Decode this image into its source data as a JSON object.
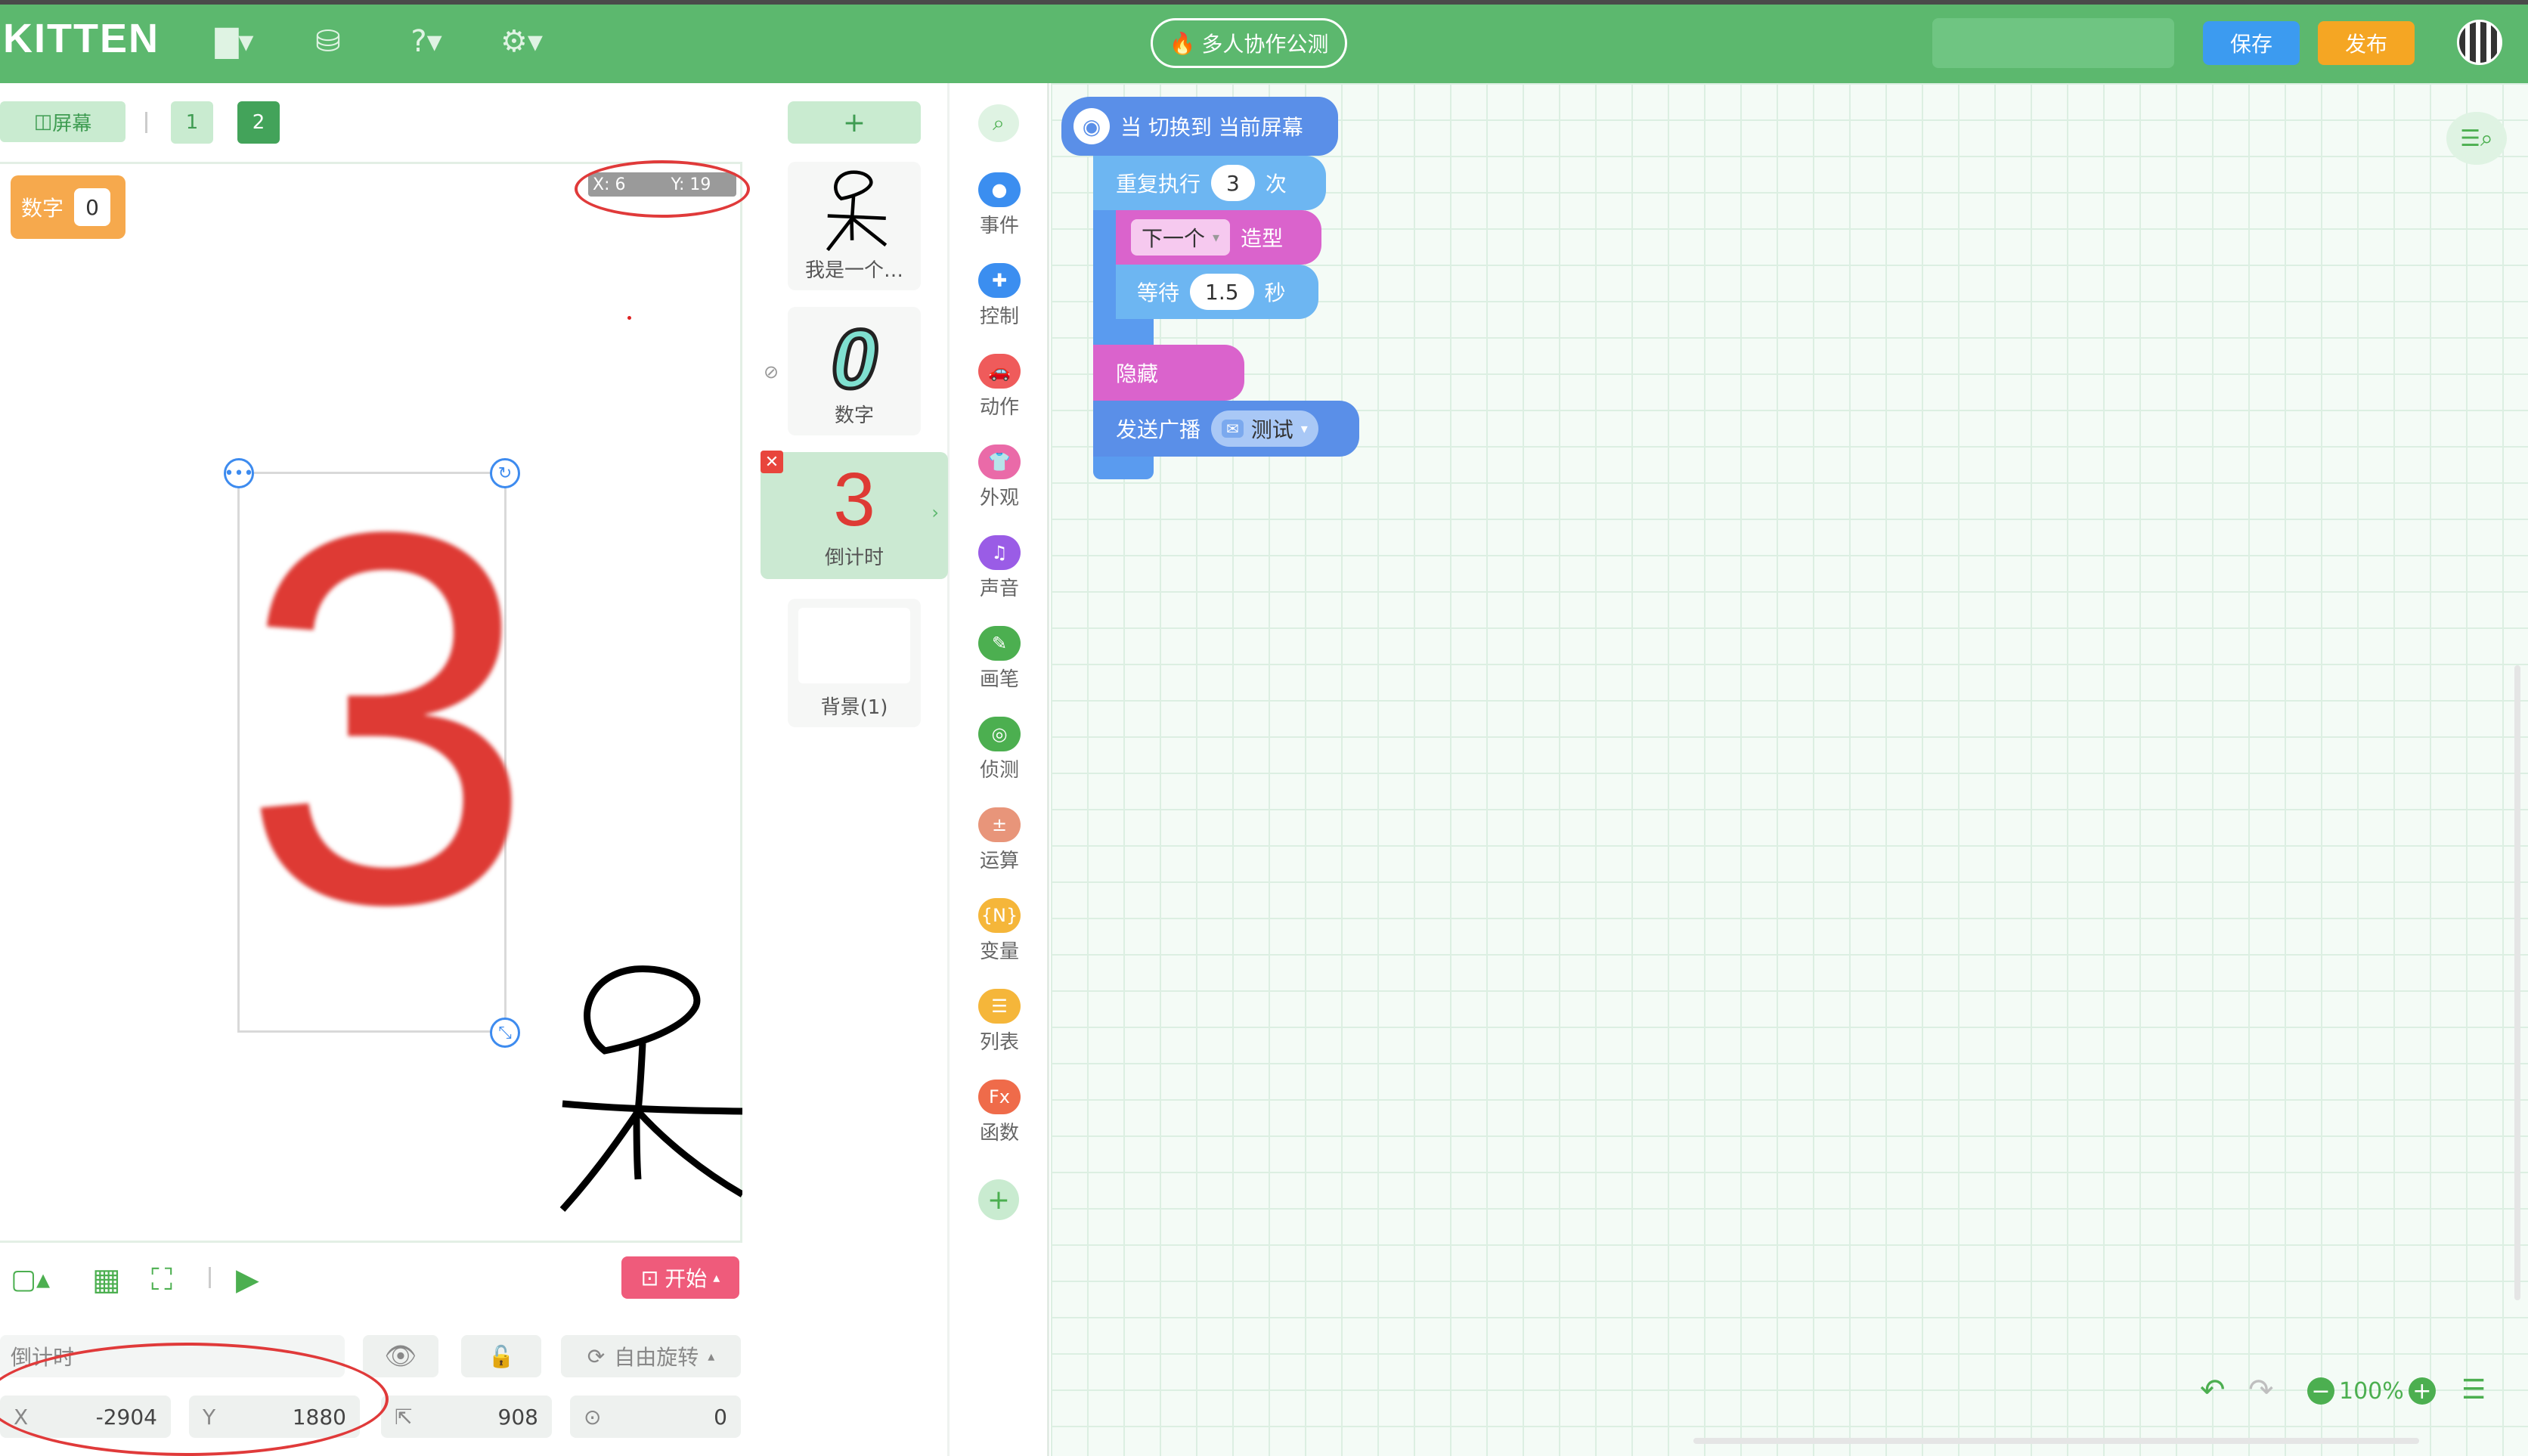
{
  "header": {
    "logo": "KITTEN",
    "collab_label": "多人协作公测",
    "save_label": "保存",
    "publish_label": "发布",
    "icons": [
      "folder-icon",
      "backpack-icon",
      "help-icon",
      "settings-icon"
    ]
  },
  "stage_toolbar": {
    "screen_label": "屏幕",
    "pages": [
      "1",
      "2"
    ],
    "active_page": "2"
  },
  "stage": {
    "variable_monitor": {
      "label": "数字",
      "value": "0"
    },
    "coords_tip": {
      "x": "X: 6",
      "y": "Y: 19"
    },
    "big_number": "3"
  },
  "stage_bottom": {
    "start_label": "开始"
  },
  "properties": {
    "sprite_name_placeholder": "倒计时",
    "rotation_mode": "自由旋转",
    "x_label": "X",
    "x_value": "-2904",
    "y_label": "Y",
    "y_value": "1880",
    "size_value": "908",
    "direction_value": "0"
  },
  "sprites": {
    "add_label": "+",
    "items": [
      {
        "name": "我是一个…"
      },
      {
        "name": "数字",
        "glyph": "0"
      },
      {
        "name": "倒计时",
        "glyph": "3"
      },
      {
        "name": "背景(1)"
      }
    ]
  },
  "categories": [
    {
      "label": "事件",
      "color": "#3b8ef0",
      "icon": "event-icon"
    },
    {
      "label": "控制",
      "color": "#3b8ef0",
      "icon": "control-icon"
    },
    {
      "label": "动作",
      "color": "#ef5b5b",
      "icon": "motion-icon"
    },
    {
      "label": "外观",
      "color": "#ea6aa8",
      "icon": "looks-icon"
    },
    {
      "label": "声音",
      "color": "#9a5ce6",
      "icon": "sound-icon"
    },
    {
      "label": "画笔",
      "color": "#4caf50",
      "icon": "pen-icon"
    },
    {
      "label": "侦测",
      "color": "#4caf50",
      "icon": "sensing-icon"
    },
    {
      "label": "运算",
      "color": "#e8957a",
      "icon": "operator-icon"
    },
    {
      "label": "变量",
      "color": "#f5b63a",
      "icon": "variable-icon"
    },
    {
      "label": "列表",
      "color": "#f5b63a",
      "icon": "list-icon"
    },
    {
      "label": "函数",
      "color": "#ef6b4a",
      "icon": "function-icon"
    }
  ],
  "cat_glyphs": [
    "●",
    "✚",
    "🚗",
    "👕",
    "♫",
    "✎",
    "◎",
    "±",
    "{N}",
    "☰",
    "Fx"
  ],
  "blocks": {
    "hat": "当 切换到 当前屏幕",
    "repeat": "重复执行",
    "repeat_count": "3",
    "repeat_unit": "次",
    "next_costume_dropdown": "下一个",
    "costume_suffix": "造型",
    "wait": "等待",
    "wait_value": "1.5",
    "wait_unit": "秒",
    "hide": "隐藏",
    "broadcast": "发送广播",
    "broadcast_msg": "测试"
  },
  "workspace": {
    "zoom": "100%"
  }
}
